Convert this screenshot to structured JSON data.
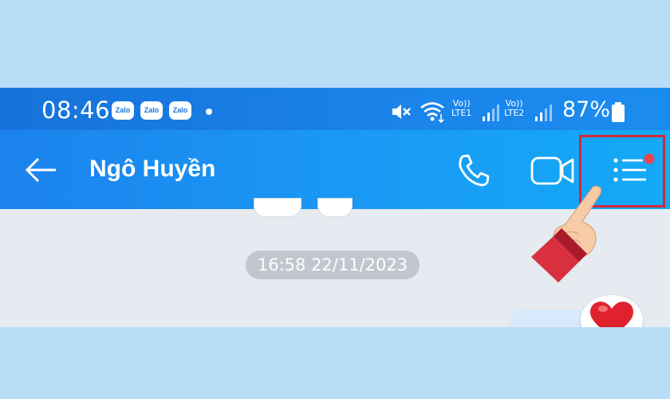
{
  "status_bar": {
    "time": "08:46",
    "notification_badges": [
      "Zalo",
      "Zalo",
      "Zalo"
    ],
    "sim1_label_top": "Vo))",
    "sim1_label_bottom": "LTE1",
    "sim2_label_top": "Vo))",
    "sim2_label_bottom": "LTE2",
    "battery": "87%"
  },
  "app_bar": {
    "back_icon": "arrow-left-icon",
    "contact_name": "Ngô Huyền",
    "call_icon": "phone-icon",
    "video_icon": "video-camera-icon",
    "menu_icon": "list-menu-icon",
    "menu_notification_color": "#e8474f"
  },
  "chat": {
    "timestamp": "16:58 22/11/2023",
    "reaction_icon": "heart-icon"
  },
  "colors": {
    "highlight_border": "#d1283a",
    "app_bar": "#1a98f4"
  }
}
